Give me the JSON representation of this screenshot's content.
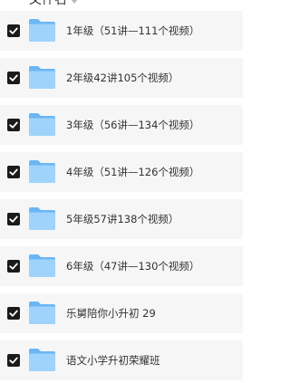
{
  "header": {
    "column_title": "文件名",
    "sort_icon": "sort-down-icon"
  },
  "files": [
    {
      "name": "1年级（51讲—111个视频）",
      "checked": true,
      "icon": "folder-icon"
    },
    {
      "name": "2年级42讲105个视频）",
      "checked": true,
      "icon": "folder-icon"
    },
    {
      "name": "3年级（56讲—134个视频）",
      "checked": true,
      "icon": "folder-icon"
    },
    {
      "name": "4年级（51讲—126个视频）",
      "checked": true,
      "icon": "folder-icon"
    },
    {
      "name": "5年级57讲138个视频）",
      "checked": true,
      "icon": "folder-icon"
    },
    {
      "name": "6年级（47讲—130个视频）",
      "checked": true,
      "icon": "folder-icon"
    },
    {
      "name": "乐舅陪你小升初 29",
      "checked": true,
      "icon": "folder-icon"
    },
    {
      "name": "语文小学升初荣耀班",
      "checked": true,
      "icon": "folder-icon"
    }
  ],
  "colors": {
    "row_background": "#f6f6f7",
    "checkbox": "#1a1a1a",
    "folder_light": "#9fd3fb",
    "folder_dark": "#6ab6f5",
    "text": "#333333"
  }
}
